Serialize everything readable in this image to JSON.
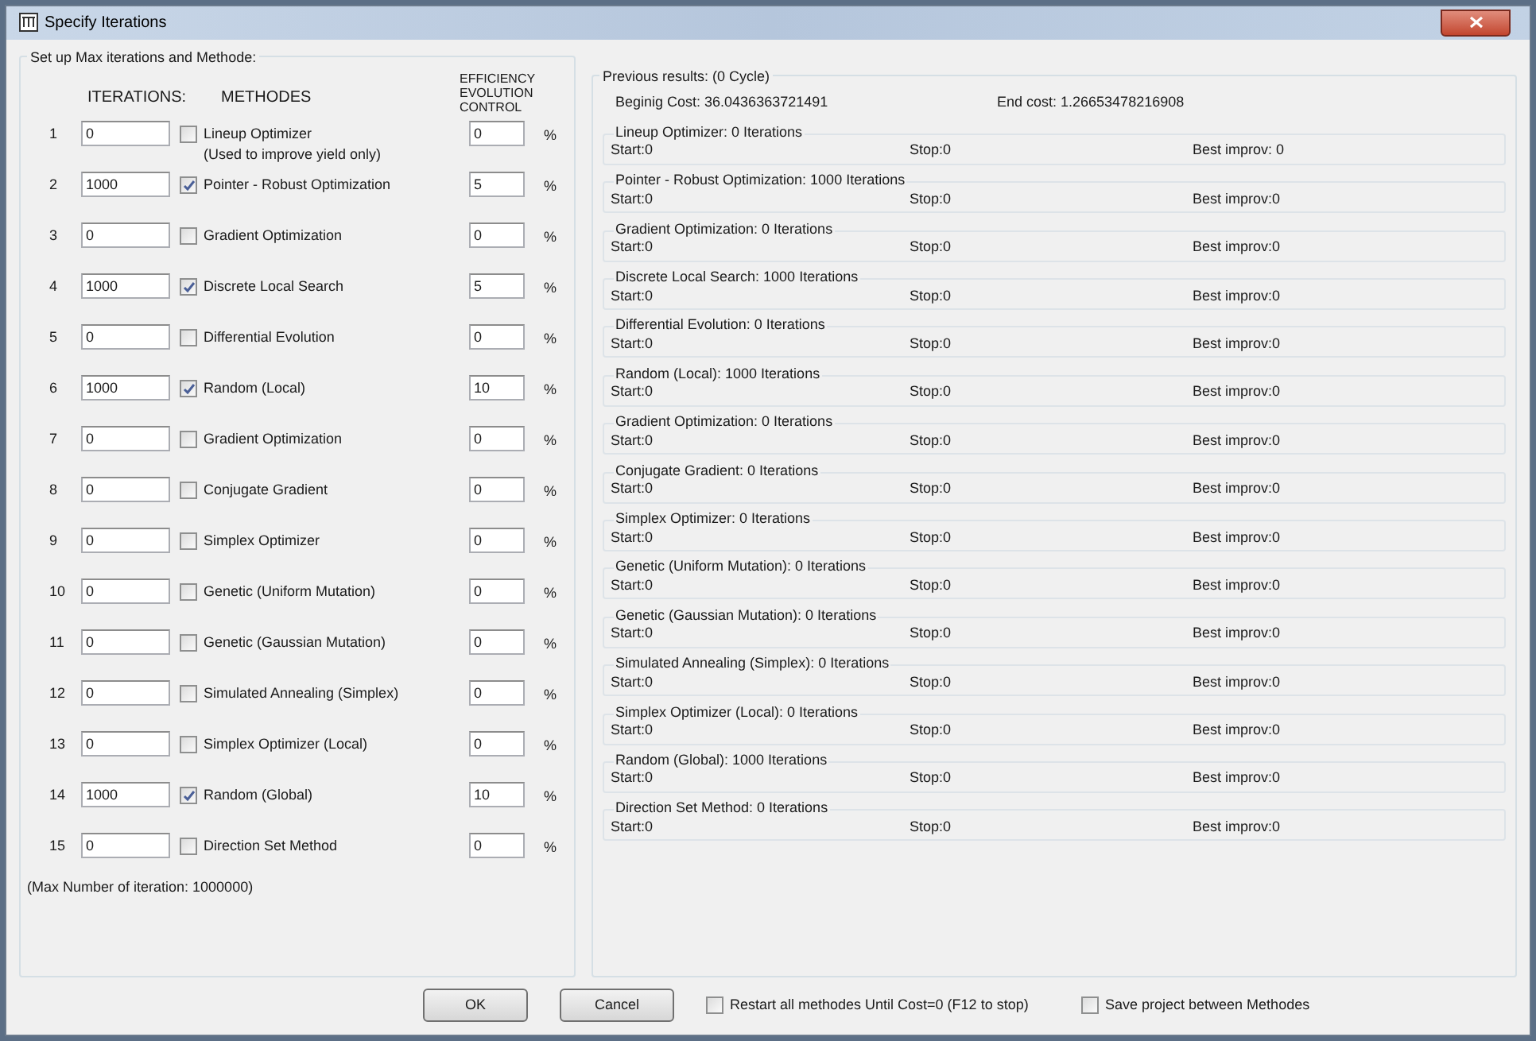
{
  "window": {
    "title": "Specify Iterations"
  },
  "setup": {
    "title": "Set up Max iterations and Methode:",
    "columns": [
      "ITERATIONS:",
      "METHODES",
      "EFFICIENCY EVOLUTION CONTROL"
    ],
    "rows": [
      {
        "number": "1",
        "iterations": "0",
        "checked": false,
        "method": "Lineup Optimizer",
        "note": "(Used to improve yield only)",
        "efficiency": "0",
        "unit": "%"
      },
      {
        "number": "2",
        "iterations": "1000",
        "checked": true,
        "method": "Pointer - Robust Optimization",
        "efficiency": "5",
        "unit": "%"
      },
      {
        "number": "3",
        "iterations": "0",
        "checked": false,
        "method": "Gradient Optimization",
        "efficiency": "0",
        "unit": "%"
      },
      {
        "number": "4",
        "iterations": "1000",
        "checked": true,
        "method": "Discrete Local Search",
        "efficiency": "5",
        "unit": "%"
      },
      {
        "number": "5",
        "iterations": "0",
        "checked": false,
        "method": "Differential Evolution",
        "efficiency": "0",
        "unit": "%"
      },
      {
        "number": "6",
        "iterations": "1000",
        "checked": true,
        "method": "Random (Local)",
        "efficiency": "10",
        "unit": "%"
      },
      {
        "number": "7",
        "iterations": "0",
        "checked": false,
        "method": "Gradient Optimization",
        "efficiency": "0",
        "unit": "%"
      },
      {
        "number": "8",
        "iterations": "0",
        "checked": false,
        "method": "Conjugate Gradient",
        "efficiency": "0",
        "unit": "%"
      },
      {
        "number": "9",
        "iterations": "0",
        "checked": false,
        "method": "Simplex Optimizer",
        "efficiency": "0",
        "unit": "%"
      },
      {
        "number": "10",
        "iterations": "0",
        "checked": false,
        "method": "Genetic (Uniform Mutation)",
        "efficiency": "0",
        "unit": "%"
      },
      {
        "number": "11",
        "iterations": "0",
        "checked": false,
        "method": "Genetic (Gaussian Mutation)",
        "efficiency": "0",
        "unit": "%"
      },
      {
        "number": "12",
        "iterations": "0",
        "checked": false,
        "method": "Simulated Annealing (Simplex)",
        "efficiency": "0",
        "unit": "%"
      },
      {
        "number": "13",
        "iterations": "0",
        "checked": false,
        "method": "Simplex Optimizer (Local)",
        "efficiency": "0",
        "unit": "%"
      },
      {
        "number": "14",
        "iterations": "1000",
        "checked": true,
        "method": "Random (Global)",
        "efficiency": "10",
        "unit": "%"
      },
      {
        "number": "15",
        "iterations": "0",
        "checked": false,
        "method": "Direction Set Method",
        "efficiency": "0",
        "unit": "%"
      }
    ],
    "max_note": "(Max Number of iteration: 1000000)"
  },
  "results": {
    "title": "Previous results: (0 Cycle)",
    "begin_cost": "Beginig Cost: 36.0436363721491",
    "end_cost": "End cost: 1.26653478216908",
    "groups": [
      {
        "title": "Lineup Optimizer: 0 Iterations",
        "start": "Start:0",
        "stop": "Stop:0",
        "best": "Best improv: 0"
      },
      {
        "title": "Pointer - Robust Optimization: 1000 Iterations",
        "start": "Start:0",
        "stop": "Stop:0",
        "best": "Best improv:0"
      },
      {
        "title": "Gradient Optimization: 0 Iterations",
        "start": "Start:0",
        "stop": "Stop:0",
        "best": "Best improv:0"
      },
      {
        "title": "Discrete Local Search: 1000 Iterations",
        "start": "Start:0",
        "stop": "Stop:0",
        "best": "Best improv:0"
      },
      {
        "title": "Differential Evolution: 0 Iterations",
        "start": "Start:0",
        "stop": "Stop:0",
        "best": "Best improv:0"
      },
      {
        "title": "Random (Local): 1000 Iterations",
        "start": "Start:0",
        "stop": "Stop:0",
        "best": "Best improv:0"
      },
      {
        "title": "Gradient Optimization: 0 Iterations",
        "start": "Start:0",
        "stop": "Stop:0",
        "best": "Best improv:0"
      },
      {
        "title": "Conjugate Gradient: 0 Iterations",
        "start": "Start:0",
        "stop": "Stop:0",
        "best": "Best improv:0"
      },
      {
        "title": "Simplex Optimizer: 0 Iterations",
        "start": "Start:0",
        "stop": "Stop:0",
        "best": "Best improv:0"
      },
      {
        "title": "Genetic (Uniform Mutation): 0 Iterations",
        "start": "Start:0",
        "stop": "Stop:0",
        "best": "Best improv:0"
      },
      {
        "title": "Genetic (Gaussian Mutation): 0 Iterations",
        "start": "Start:0",
        "stop": "Stop:0",
        "best": "Best improv:0"
      },
      {
        "title": "Simulated Annealing (Simplex): 0 Iterations",
        "start": "Start:0",
        "stop": "Stop:0",
        "best": "Best improv:0"
      },
      {
        "title": "Simplex Optimizer (Local): 0 Iterations",
        "start": "Start:0",
        "stop": "Stop:0",
        "best": "Best improv:0"
      },
      {
        "title": "Random (Global): 1000 Iterations",
        "start": "Start:0",
        "stop": "Stop:0",
        "best": "Best improv:0"
      },
      {
        "title": "Direction Set Method: 0 Iterations",
        "start": "Start:0",
        "stop": "Stop:0",
        "best": "Best improv:0"
      }
    ]
  },
  "buttons": [
    "OK",
    "Cancel"
  ],
  "options": [
    {
      "label": "Restart all methodes Until Cost=0 (F12 to stop)",
      "checked": false
    },
    {
      "label": "Save project between Methodes",
      "checked": false
    }
  ]
}
